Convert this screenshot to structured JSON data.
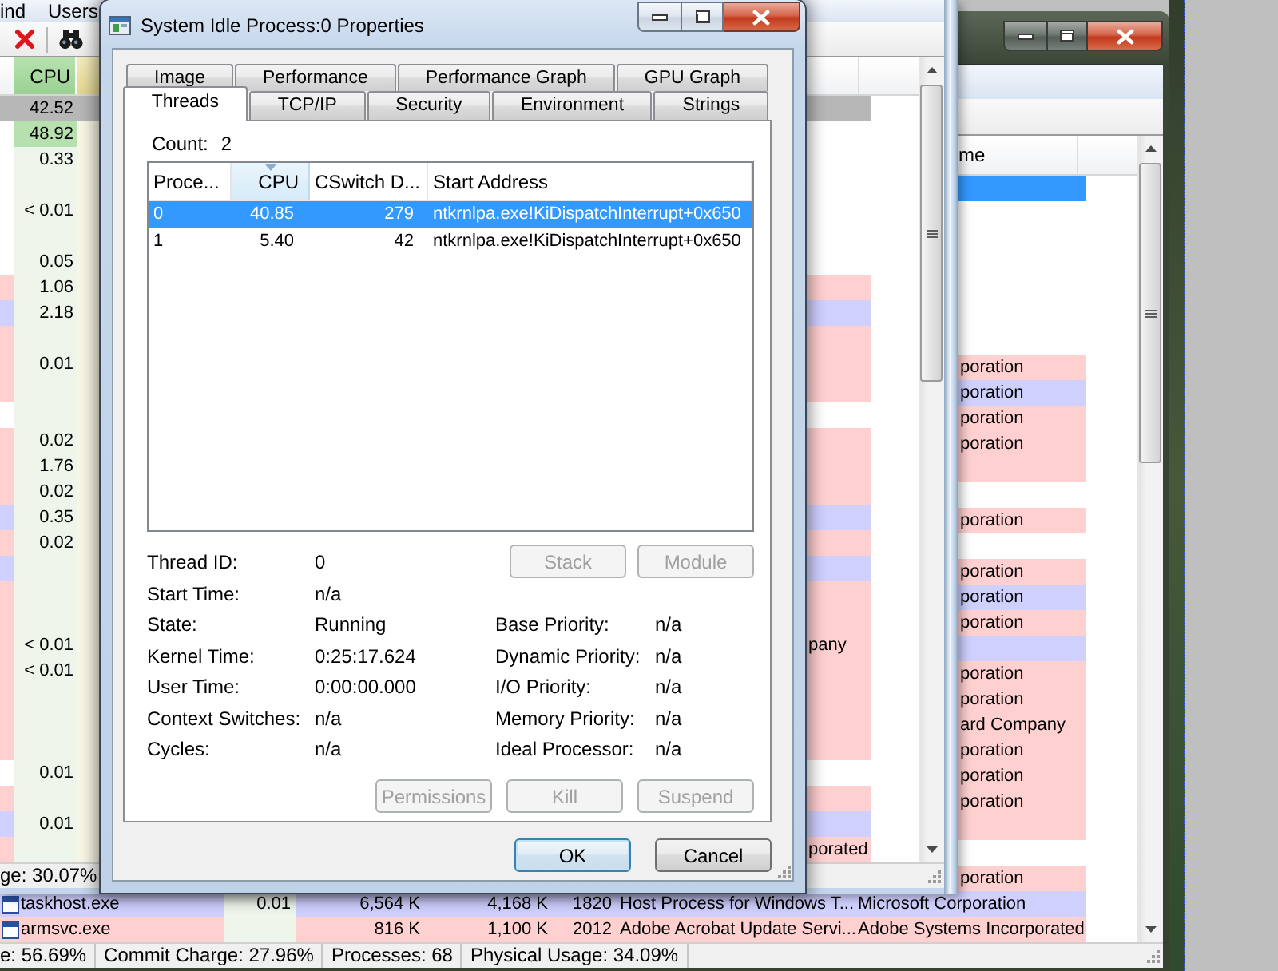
{
  "process_window": {
    "menu": [
      "ind",
      "Users"
    ],
    "cpu_header": "CPU",
    "rows": [
      {
        "selected": true,
        "highlighted": false,
        "cpu": "42.52"
      },
      {
        "selected": false,
        "highlighted": true,
        "color": "#ffffff",
        "cpu": "48.92"
      },
      {
        "selected": false,
        "highlighted": false,
        "color": "#ffffff",
        "cpu": "0.33"
      },
      {
        "selected": false,
        "highlighted": false,
        "color": "#ffffff"
      },
      {
        "selected": false,
        "highlighted": false,
        "color": "#ffffff",
        "cpu": "< 0.01"
      },
      {
        "selected": false,
        "highlighted": false,
        "color": "#ffffff"
      },
      {
        "selected": false,
        "highlighted": false,
        "color": "#ffffff",
        "cpu": "0.05"
      },
      {
        "selected": false,
        "highlighted": false,
        "color": "#ffd0d0",
        "cpu": "1.06"
      },
      {
        "selected": false,
        "highlighted": false,
        "color": "#d0d0ff",
        "cpu": "2.18"
      },
      {
        "selected": false,
        "highlighted": false,
        "color": "#ffd0d0"
      },
      {
        "selected": false,
        "highlighted": false,
        "color": "#ffd0d0",
        "cpu": "0.01"
      },
      {
        "selected": false,
        "highlighted": false,
        "color": "#ffd0d0"
      },
      {
        "selected": false,
        "highlighted": false,
        "color": "#ffffff"
      },
      {
        "selected": false,
        "highlighted": false,
        "color": "#ffd0d0",
        "cpu": "0.02"
      },
      {
        "selected": false,
        "highlighted": false,
        "color": "#ffd0d0",
        "cpu": "1.76"
      },
      {
        "selected": false,
        "highlighted": false,
        "color": "#ffd0d0",
        "cpu": "0.02"
      },
      {
        "selected": false,
        "highlighted": false,
        "color": "#d0d0ff",
        "cpu": "0.35"
      },
      {
        "selected": false,
        "highlighted": false,
        "color": "#ffd0d0",
        "cpu": "0.02"
      },
      {
        "selected": false,
        "highlighted": false,
        "color": "#d0d0ff"
      },
      {
        "selected": false,
        "highlighted": false,
        "color": "#ffd0d0"
      },
      {
        "selected": false,
        "highlighted": false,
        "color": "#ffd0d0"
      },
      {
        "selected": false,
        "highlighted": false,
        "color": "#ffd0d0",
        "cpu": "< 0.01",
        "company": "pany"
      },
      {
        "selected": false,
        "highlighted": false,
        "color": "#ffd0d0",
        "cpu": "< 0.01"
      },
      {
        "selected": false,
        "highlighted": false,
        "color": "#ffd0d0"
      },
      {
        "selected": false,
        "highlighted": false,
        "color": "#ffd0d0"
      },
      {
        "selected": false,
        "highlighted": false,
        "color": "#ffd0d0"
      },
      {
        "selected": false,
        "highlighted": false,
        "color": "#ffffff",
        "cpu": "0.01"
      },
      {
        "selected": false,
        "highlighted": false,
        "color": "#ffd0d0"
      },
      {
        "selected": false,
        "highlighted": false,
        "color": "#d0d0ff",
        "cpu": "0.01"
      },
      {
        "selected": false,
        "highlighted": false,
        "color": "#ffd0d0",
        "company": "porated"
      }
    ],
    "status_bar": "ge: 30.07%"
  },
  "dialog": {
    "title": "System Idle Process:0 Properties",
    "tab_rows": [
      [
        {
          "label": "Image",
          "selected": false
        },
        {
          "label": "Performance",
          "selected": false
        },
        {
          "label": "Performance Graph",
          "selected": false
        },
        {
          "label": "GPU Graph",
          "selected": false
        }
      ],
      [
        {
          "label": "Threads",
          "selected": true
        },
        {
          "label": "TCP/IP",
          "selected": false
        },
        {
          "label": "Security",
          "selected": false
        },
        {
          "label": "Environment",
          "selected": false
        },
        {
          "label": "Strings",
          "selected": false
        }
      ]
    ],
    "count_label": "Count:",
    "count": "2",
    "threads": {
      "columns": [
        {
          "label": "Proce...",
          "sorted": false
        },
        {
          "label": "CPU",
          "sorted": true
        },
        {
          "label": "CSwitch D...",
          "sorted": false
        },
        {
          "label": "Start Address",
          "sorted": false
        }
      ],
      "rows": [
        {
          "selected": true,
          "cells": [
            "0",
            "40.85",
            "279",
            "ntkrnlpa.exe!KiDispatchInterrupt+0x650"
          ]
        },
        {
          "selected": false,
          "cells": [
            "1",
            "5.40",
            "42",
            "ntkrnlpa.exe!KiDispatchInterrupt+0x650"
          ]
        }
      ]
    },
    "thread_info": [
      {
        "label": "Thread ID:",
        "value": "0"
      },
      {
        "label": "Start Time:",
        "value": "n/a"
      },
      {
        "label": "State:",
        "value": "Running"
      },
      {
        "label": "Kernel Time:",
        "value": "0:25:17.624"
      },
      {
        "label": "User Time:",
        "value": "0:00:00.000"
      },
      {
        "label": "Context Switches:",
        "value": "n/a"
      },
      {
        "label": "Cycles:",
        "value": "n/a"
      }
    ],
    "thread_buttons": [
      {
        "label": "Stack",
        "disabled": true
      },
      {
        "label": "Module",
        "disabled": true
      }
    ],
    "priority_info": [
      {
        "label": "Base Priority:",
        "value": "n/a"
      },
      {
        "label": "Dynamic Priority:",
        "value": "n/a"
      },
      {
        "label": "I/O Priority:",
        "value": "n/a"
      },
      {
        "label": "Memory Priority:",
        "value": "n/a"
      },
      {
        "label": "Ideal Processor:",
        "value": "n/a"
      }
    ],
    "action_buttons": [
      {
        "label": "Permissions",
        "disabled": true
      },
      {
        "label": "Kill",
        "disabled": true
      },
      {
        "label": "Suspend",
        "disabled": true
      }
    ],
    "footer_buttons": [
      {
        "label": "OK",
        "default": true
      },
      {
        "label": "Cancel",
        "default": false
      }
    ]
  },
  "background_window": {
    "column_header": "me",
    "rows": [
      {
        "kind": "partial",
        "selected": true
      },
      {
        "kind": "partial",
        "selected": false,
        "color": "#ffffff"
      },
      {
        "kind": "partial",
        "selected": false,
        "color": "#ffffff"
      },
      {
        "kind": "partial",
        "selected": false,
        "color": "#ffffff"
      },
      {
        "kind": "partial",
        "selected": false,
        "color": "#ffffff"
      },
      {
        "kind": "partial",
        "selected": false,
        "color": "#ffffff"
      },
      {
        "kind": "partial",
        "selected": false,
        "color": "#ffffff"
      },
      {
        "kind": "partial",
        "selected": false,
        "color": "#ffd0d0",
        "company": "poration"
      },
      {
        "kind": "partial",
        "selected": false,
        "color": "#d0d0ff",
        "company": "poration"
      },
      {
        "kind": "partial",
        "selected": false,
        "color": "#ffd0d0",
        "company": "poration"
      },
      {
        "kind": "partial",
        "selected": false,
        "color": "#ffd0d0",
        "company": "poration"
      },
      {
        "kind": "partial",
        "selected": false,
        "color": "#ffd0d0"
      },
      {
        "kind": "partial",
        "selected": false,
        "color": "#ffffff"
      },
      {
        "kind": "partial",
        "selected": false,
        "color": "#ffd0d0",
        "company": "poration"
      },
      {
        "kind": "partial",
        "selected": false,
        "color": "#ffffff"
      },
      {
        "kind": "partial",
        "selected": false,
        "color": "#ffd0d0",
        "company": "poration"
      },
      {
        "kind": "partial",
        "selected": false,
        "color": "#d0d0ff",
        "company": "poration"
      },
      {
        "kind": "partial",
        "selected": false,
        "color": "#ffd0d0",
        "company": "poration"
      },
      {
        "kind": "partial",
        "selected": false,
        "color": "#d0d0ff"
      },
      {
        "kind": "partial",
        "selected": false,
        "color": "#ffd0d0",
        "company": "poration"
      },
      {
        "kind": "partial",
        "selected": false,
        "color": "#ffd0d0",
        "company": "poration"
      },
      {
        "kind": "partial",
        "selected": false,
        "color": "#ffd0d0",
        "company": "ard Company"
      },
      {
        "kind": "partial",
        "selected": false,
        "color": "#ffd0d0",
        "company": "poration"
      },
      {
        "kind": "partial",
        "selected": false,
        "color": "#ffd0d0",
        "company": "poration"
      },
      {
        "kind": "partial",
        "selected": false,
        "color": "#ffd0d0",
        "company": "poration"
      },
      {
        "kind": "partial",
        "selected": false,
        "color": "#ffd0d0"
      },
      {
        "kind": "partial",
        "selected": false,
        "color": "#ffffff"
      },
      {
        "kind": "partial",
        "selected": false,
        "color": "#ffd0d0",
        "company": "poration"
      },
      {
        "kind": "full",
        "selected": false,
        "color": "#d0d0ff",
        "name": "taskhost.exe",
        "cpu": "0.01",
        "private_bytes": "6,564 K",
        "working_set": "4,168 K",
        "pid": "1820",
        "description": "Host Process for Windows T...",
        "company": "Microsoft Corporation"
      },
      {
        "kind": "full",
        "selected": false,
        "color": "#ffd0d0",
        "name": "armsvc.exe",
        "private_bytes": "816 K",
        "working_set": "1,100 K",
        "pid": "2012",
        "description": "Adobe Acrobat Update Servi...",
        "company": "Adobe Systems Incorporated"
      }
    ],
    "status_bar": [
      "e: 56.69%",
      "Commit Charge: 27.96%",
      "Processes: 68",
      "Physical Usage: 34.09%"
    ]
  }
}
